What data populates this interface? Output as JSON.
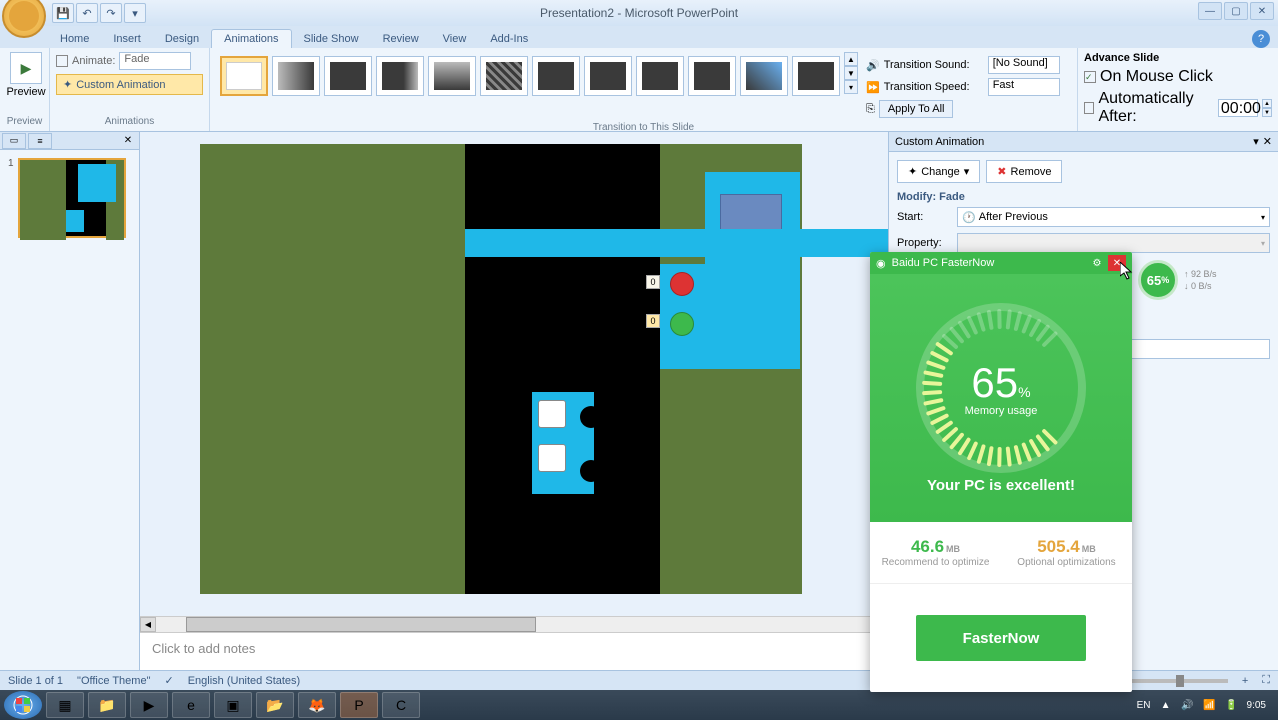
{
  "title": "Presentation2 - Microsoft PowerPoint",
  "ribbon_tabs": [
    "Home",
    "Insert",
    "Design",
    "Animations",
    "Slide Show",
    "Review",
    "View",
    "Add-Ins"
  ],
  "active_tab": "Animations",
  "preview_label": "Preview",
  "preview_group_label": "Preview",
  "animate_label": "Animate:",
  "animate_value": "Fade",
  "custom_anim_btn": "Custom Animation",
  "animations_group_label": "Animations",
  "transitions_group_label": "Transition to This Slide",
  "trans_sound_label": "Transition Sound:",
  "trans_sound_value": "[No Sound]",
  "trans_speed_label": "Transition Speed:",
  "trans_speed_value": "Fast",
  "apply_all": "Apply To All",
  "advance_label": "Advance Slide",
  "on_click": "On Mouse Click",
  "auto_after": "Automatically After:",
  "auto_time": "00:00",
  "slide_tag0_a": "0",
  "slide_tag0_b": "0",
  "notes_placeholder": "Click to add notes",
  "pane": {
    "title": "Custom Animation",
    "change": "Change",
    "remove": "Remove",
    "modify": "Modify: Fade",
    "start_label": "Start:",
    "start_value": "After Previous",
    "property_label": "Property:"
  },
  "baidu": {
    "title": "Baidu PC FasterNow",
    "gauge_val": "65",
    "gauge_pct": "%",
    "gauge_label": "Memory usage",
    "status": "Your PC is excellent!",
    "stat1_val": "46.6",
    "stat1_unit": "MB",
    "stat1_label": "Recommend to optimize",
    "stat2_val": "505.4",
    "stat2_unit": "MB",
    "stat2_label": "Optional optimizations",
    "action": "FasterNow"
  },
  "float": {
    "val": "65",
    "pct": "%",
    "up": "92 B/s",
    "down": "0 B/s"
  },
  "status": {
    "slide": "Slide 1 of 1",
    "theme": "\"Office Theme\"",
    "lang": "English (United States)"
  },
  "tray": {
    "lang": "EN",
    "time": "9:05"
  }
}
